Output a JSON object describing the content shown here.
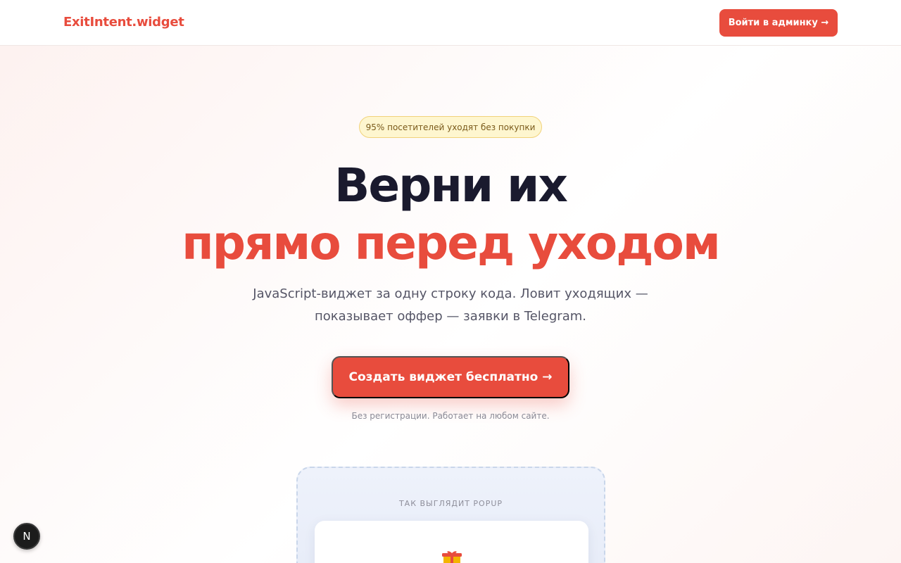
{
  "header": {
    "logo": "ExitIntent.widget",
    "admin_button": "Войти в админку →"
  },
  "hero": {
    "badge": "95% посетителей уходят без покупки",
    "title_line1": "Верни их",
    "title_line2": "прямо перед уходом",
    "subtitle_line1": "JavaScript-виджет за одну строку кода. Ловит уходящих —",
    "subtitle_line2": "показывает оффер — заявки в Telegram.",
    "cta": "Создать виджет бесплатно →",
    "note": "Без регистрации. Работает на любом сайте."
  },
  "preview": {
    "label": "ТАК ВЫГЛЯДИТ POPUP",
    "icon": "gift-icon"
  },
  "dev_badge": {
    "label": "N"
  },
  "colors": {
    "accent": "#e84c3d",
    "heading": "#1a1a2e",
    "badge_bg": "#fef6cf"
  }
}
